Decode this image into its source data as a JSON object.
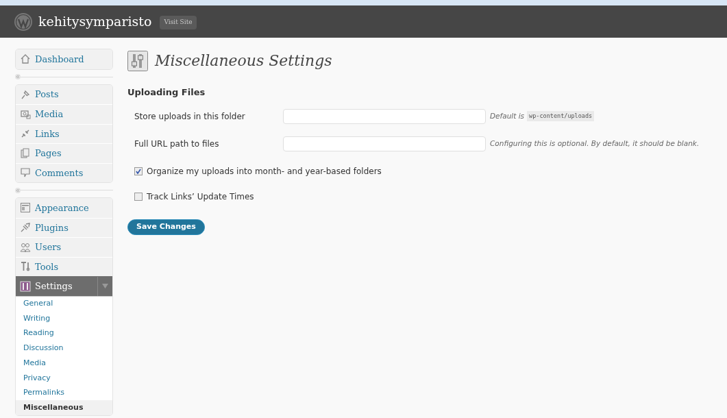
{
  "header": {
    "site_title": "kehitysymparisto",
    "visit_site": "Visit Site"
  },
  "menu": [
    {
      "items": [
        {
          "label": "Dashboard",
          "selected": false
        }
      ]
    },
    {
      "items": [
        {
          "label": "Posts",
          "selected": false
        },
        {
          "label": "Media",
          "selected": false
        },
        {
          "label": "Links",
          "selected": false
        },
        {
          "label": "Pages",
          "selected": false
        },
        {
          "label": "Comments",
          "selected": false
        }
      ]
    },
    {
      "items": [
        {
          "label": "Appearance",
          "selected": false
        },
        {
          "label": "Plugins",
          "selected": false
        },
        {
          "label": "Users",
          "selected": false
        },
        {
          "label": "Tools",
          "selected": false
        },
        {
          "label": "Settings",
          "selected": true,
          "expanded": true,
          "children": [
            {
              "label": "General",
              "selected": false
            },
            {
              "label": "Writing",
              "selected": false
            },
            {
              "label": "Reading",
              "selected": false
            },
            {
              "label": "Discussion",
              "selected": false
            },
            {
              "label": "Media",
              "selected": false
            },
            {
              "label": "Privacy",
              "selected": false
            },
            {
              "label": "Permalinks",
              "selected": false
            },
            {
              "label": "Miscellaneous",
              "selected": true
            }
          ]
        }
      ]
    }
  ],
  "page_title": "Miscellaneous Settings",
  "section_title": "Uploading Files",
  "fields": [
    {
      "label": "Store uploads in this folder",
      "hint": "Default is",
      "hint_code": "wp-content/uploads"
    },
    {
      "label": "Full URL path to files",
      "hint": "Configuring this is optional. By default, it should be blank."
    }
  ],
  "checkboxes": [
    {
      "label": "Organize my uploads into month- and year-based folders",
      "checked": true
    },
    {
      "label": "Track Links’ Update Times",
      "checked": false
    }
  ],
  "save_button": "Save Changes"
}
